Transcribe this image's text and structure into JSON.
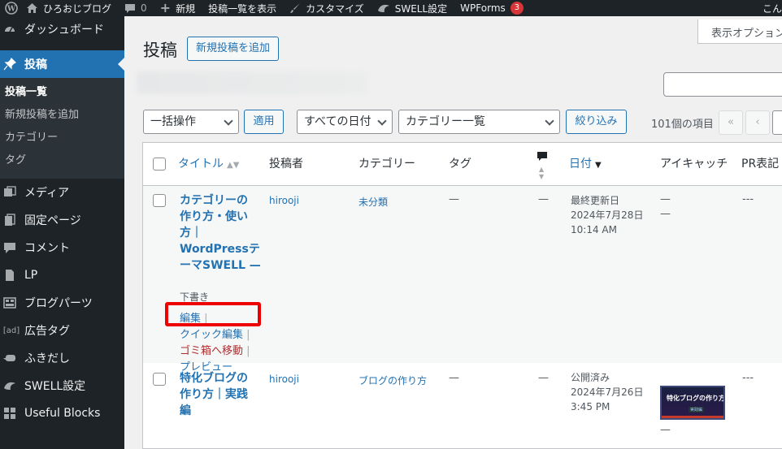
{
  "adminbar": {
    "site_name": "ひろおじブログ",
    "comments_count": "0",
    "new_label": "新規",
    "view_posts": "投稿一覧を表示",
    "customize": "カスタマイズ",
    "swell_settings": "SWELL設定",
    "wpforms": "WPForms",
    "wpforms_badge": "3",
    "greeting": "こん"
  },
  "sidebar": {
    "dashboard": "ダッシュボード",
    "posts": "投稿",
    "submenu": [
      "投稿一覧",
      "新規投稿を追加",
      "カテゴリー",
      "タグ"
    ],
    "media": "メディア",
    "pages": "固定ページ",
    "comments": "コメント",
    "lp": "LP",
    "blog_parts": "ブログパーツ",
    "ad_tags": "広告タグ",
    "ad_tag_icon": "[ad]",
    "balloon": "ふきだし",
    "swell": "SWELL設定",
    "useful_blocks": "Useful Blocks"
  },
  "header": {
    "screen_options": "表示オプション",
    "page_title": "投稿",
    "add_new": "新規投稿を追加"
  },
  "filters": {
    "bulk_action": "一括操作",
    "apply": "適用",
    "all_dates": "すべての日付",
    "category": "カテゴリー一覧",
    "filter": "絞り込み",
    "items_count": "101個の項目",
    "first_page": "«",
    "prev_page": "‹"
  },
  "table": {
    "columns": {
      "title": "タイトル",
      "author": "投稿者",
      "categories": "カテゴリー",
      "tags": "タグ",
      "date": "日付",
      "eyecatch": "アイキャッチ",
      "pr": "PR表記"
    },
    "rows": [
      {
        "title_lines": [
          "カテゴリーの",
          "作り方・使い",
          "方｜",
          "WordPressテ",
          "ーマSWELL —"
        ],
        "state": "下書き",
        "author": "hirooji",
        "category": "未分類",
        "tags": "—",
        "comments": "—",
        "date_status": "最終更新日",
        "date": "2024年7月28日",
        "time": "10:14 AM",
        "eyecatch_1": "—",
        "eyecatch_2": "—",
        "pr": "---",
        "actions": {
          "edit": "編集",
          "quick_edit": "クイック編集",
          "trash": "ゴミ箱へ移動",
          "preview": "プレビュー",
          "sep": "|"
        }
      },
      {
        "title_lines": [
          "特化ブログの",
          "作り方｜実践",
          "編"
        ],
        "author": "hirooji",
        "category": "ブログの作り方",
        "tags": "—",
        "comments": "—",
        "date_status": "公開済み",
        "date": "2024年7月26日",
        "time": "3:45 PM",
        "thumb_text": "特化ブログの作り方",
        "thumb_sub": "実践編",
        "eyecatch_below": "—",
        "pr": "---"
      }
    ]
  },
  "colors": {
    "accent": "#2271b1",
    "sidebar_bg": "#1d2327",
    "highlight": "#e00000",
    "trash": "#b32d2e"
  }
}
